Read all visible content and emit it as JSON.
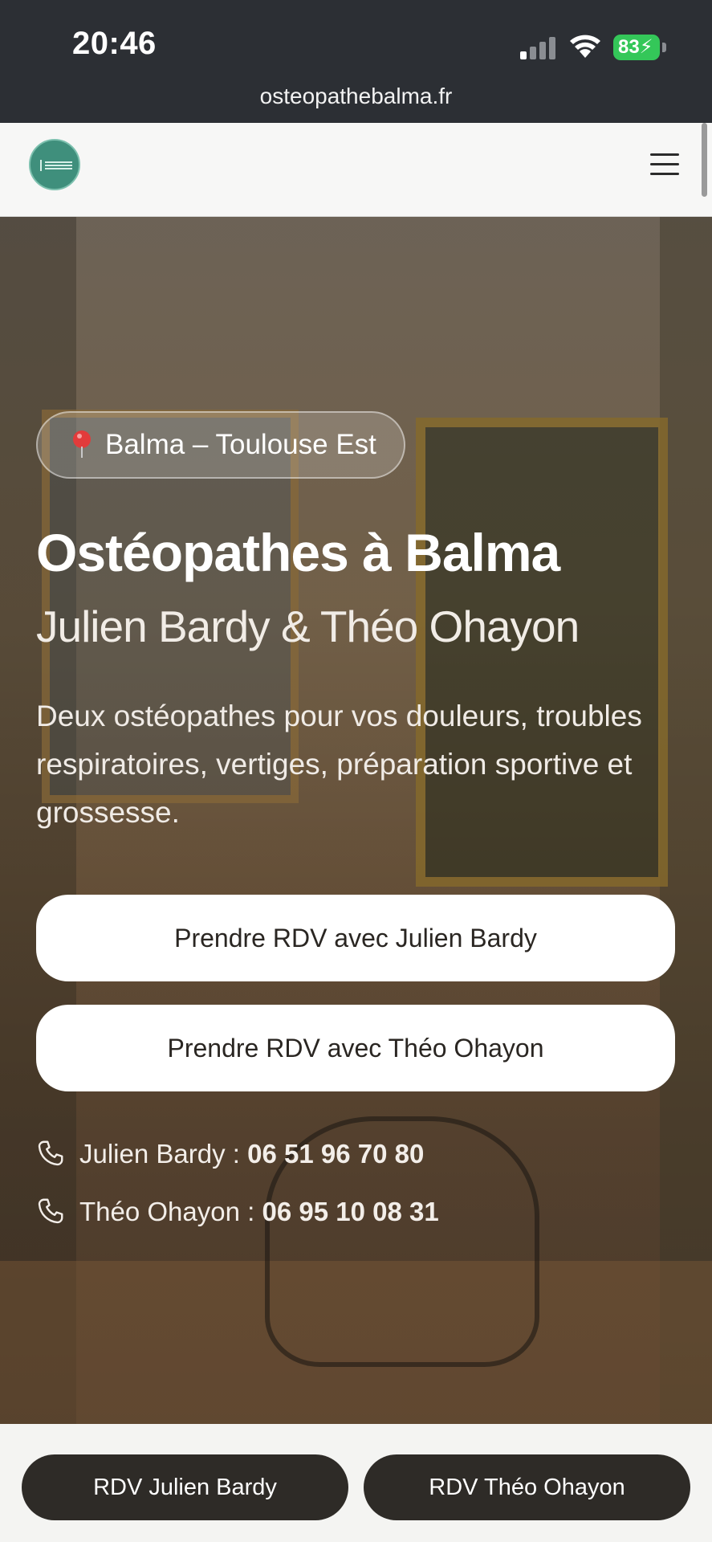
{
  "status_bar": {
    "time": "20:46",
    "battery": "83",
    "url": "osteopathebalma.fr"
  },
  "header": {
    "logo_icon": "clinic-logo",
    "menu_icon": "hamburger-menu-icon"
  },
  "hero": {
    "location_badge": "Balma – Toulouse Est",
    "location_icon": "pin-icon",
    "title": "Ostéopathes à Balma",
    "subtitle": "Julien Bardy & Théo Ohayon",
    "description": "Deux ostéopathes pour vos douleurs, troubles respiratoires, vertiges, préparation sportive et grossesse.",
    "buttons": [
      {
        "label": "Prendre RDV avec Julien Bardy"
      },
      {
        "label": "Prendre RDV avec Théo Ohayon"
      }
    ],
    "phones": [
      {
        "name": "Julien Bardy : ",
        "number": "06 51 96 70 80"
      },
      {
        "name": "Théo Ohayon : ",
        "number": "06 95 10 08 31"
      }
    ]
  },
  "bottom_bar": {
    "buttons": [
      {
        "label": "RDV Julien Bardy"
      },
      {
        "label": "RDV Théo Ohayon"
      }
    ]
  },
  "colors": {
    "status_bar_bg": "#2c2f34",
    "logo_green": "#3f8f7c",
    "battery_green": "#34c759",
    "dark_button": "#2e2b27",
    "cta_bg": "#ffffff"
  }
}
